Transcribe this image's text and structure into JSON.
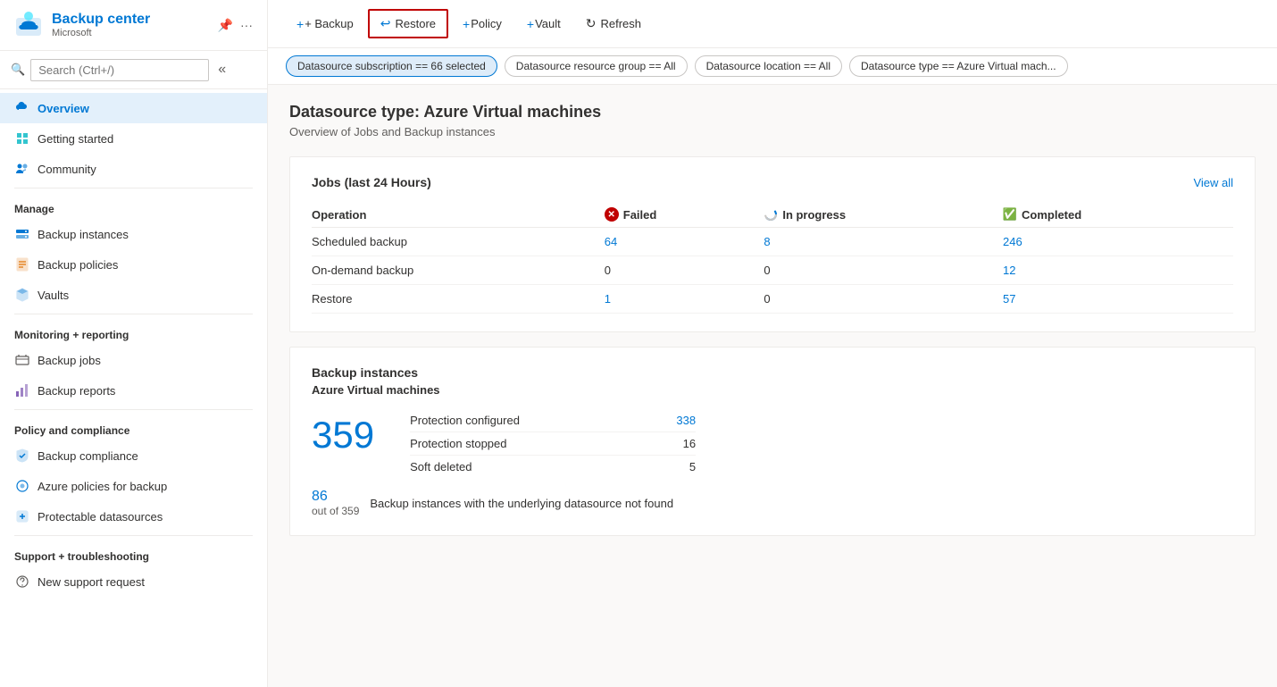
{
  "app": {
    "title": "Backup center",
    "subtitle": "Microsoft",
    "pin_icon": "📌",
    "more_icon": "..."
  },
  "sidebar": {
    "search_placeholder": "Search (Ctrl+/)",
    "nav_items": [
      {
        "id": "overview",
        "label": "Overview",
        "active": true,
        "icon": "cloud-icon"
      },
      {
        "id": "getting-started",
        "label": "Getting started",
        "active": false,
        "icon": "start-icon"
      },
      {
        "id": "community",
        "label": "Community",
        "active": false,
        "icon": "community-icon"
      }
    ],
    "manage_section": "Manage",
    "manage_items": [
      {
        "id": "backup-instances",
        "label": "Backup instances",
        "icon": "instances-icon"
      },
      {
        "id": "backup-policies",
        "label": "Backup policies",
        "icon": "policies-icon"
      },
      {
        "id": "vaults",
        "label": "Vaults",
        "icon": "vaults-icon"
      }
    ],
    "monitoring_section": "Monitoring + reporting",
    "monitoring_items": [
      {
        "id": "backup-jobs",
        "label": "Backup jobs",
        "icon": "jobs-icon"
      },
      {
        "id": "backup-reports",
        "label": "Backup reports",
        "icon": "reports-icon"
      }
    ],
    "policy_section": "Policy and compliance",
    "policy_items": [
      {
        "id": "backup-compliance",
        "label": "Backup compliance",
        "icon": "compliance-icon"
      },
      {
        "id": "azure-policies",
        "label": "Azure policies for backup",
        "icon": "azure-policies-icon"
      },
      {
        "id": "protectable",
        "label": "Protectable datasources",
        "icon": "protectable-icon"
      }
    ],
    "support_section": "Support + troubleshooting",
    "support_items": [
      {
        "id": "new-support",
        "label": "New support request",
        "icon": "support-icon"
      }
    ]
  },
  "toolbar": {
    "backup_label": "+ Backup",
    "restore_label": "↩ Restore",
    "policy_label": "+ Policy",
    "vault_label": "+ Vault",
    "refresh_label": "Refresh"
  },
  "filters": {
    "subscription": "Datasource subscription == 66 selected",
    "resource_group": "Datasource resource group == All",
    "location": "Datasource location == All",
    "type": "Datasource type == Azure Virtual mach..."
  },
  "main": {
    "title": "Datasource type: Azure Virtual machines",
    "subtitle": "Overview of Jobs and Backup instances",
    "jobs_section": {
      "title": "Jobs (last 24 Hours)",
      "view_all": "View all",
      "headers": {
        "operation": "Operation",
        "failed": "Failed",
        "in_progress": "In progress",
        "completed": "Completed"
      },
      "rows": [
        {
          "operation": "Scheduled backup",
          "failed": "64",
          "in_progress": "8",
          "completed": "246",
          "failed_color": "blue",
          "in_progress_color": "blue",
          "completed_color": "blue"
        },
        {
          "operation": "On-demand backup",
          "failed": "0",
          "in_progress": "0",
          "completed": "12",
          "failed_color": "normal",
          "in_progress_color": "normal",
          "completed_color": "blue"
        },
        {
          "operation": "Restore",
          "failed": "1",
          "in_progress": "0",
          "completed": "57",
          "failed_color": "blue",
          "in_progress_color": "normal",
          "completed_color": "blue"
        }
      ]
    },
    "backup_instances_section": {
      "title": "Backup instances",
      "datasource_type": "Azure Virtual machines",
      "total": "359",
      "protection_configured_label": "Protection configured",
      "protection_configured_value": "338",
      "protection_stopped_label": "Protection stopped",
      "protection_stopped_value": "16",
      "soft_deleted_label": "Soft deleted",
      "soft_deleted_value": "5",
      "bottom_number": "86",
      "bottom_sub": "out of 359",
      "bottom_desc": "Backup instances with the underlying datasource not found"
    }
  }
}
